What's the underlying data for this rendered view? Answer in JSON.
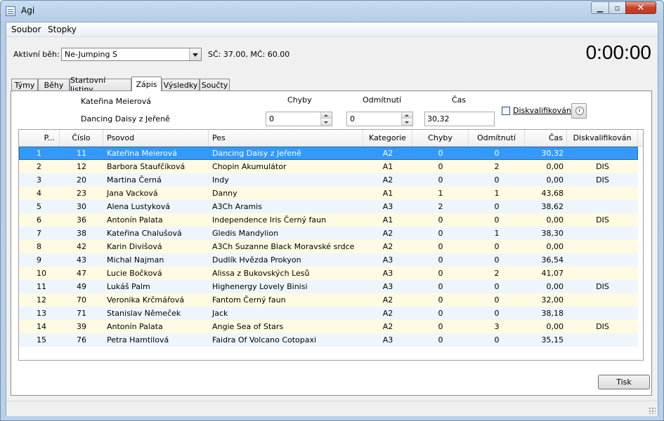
{
  "window": {
    "title": "Agi"
  },
  "menu": {
    "items": [
      "Soubor",
      "Stopky"
    ]
  },
  "run_selector": {
    "label": "Aktivní běh:",
    "value": "Ne-Jumping S"
  },
  "run_info": "SČ: 37.00, MČ: 60.00",
  "timer": "0:00:00",
  "tabs": [
    "Týmy",
    "Běhy",
    "Startovní listiny",
    "Zápis",
    "Výsledky",
    "Součty"
  ],
  "active_tab": "Zápis",
  "entry": {
    "handler": "Kateřina Meierová",
    "dog": "Dancing Daisy z Jeřeně",
    "chyby_label": "Chyby",
    "chyby_value": "0",
    "odmitnuti_label": "Odmítnutí",
    "odmitnuti_value": "0",
    "cas_label": "Čas",
    "cas_value": "30,32",
    "disq_label": "Diskvalifikován",
    "alarm_icon": "alarm-clock-icon"
  },
  "table": {
    "columns": [
      "P...",
      "Číslo",
      "Psovod",
      "Pes",
      "Kategorie",
      "Chyby",
      "Odmítnutí",
      "Čas",
      "Diskvalifikován"
    ],
    "rows": [
      [
        "1",
        "11",
        "Kateřina Meierová",
        "Dancing Daisy z Jeřeně",
        "A2",
        "0",
        "0",
        "30,32",
        ""
      ],
      [
        "2",
        "12",
        "Barbora Staufčíková",
        "Chopin Akumulátor",
        "A1",
        "0",
        "2",
        "0,00",
        "DIS"
      ],
      [
        "3",
        "20",
        "Martina Černá",
        "Indy",
        "A2",
        "0",
        "0",
        "0,00",
        "DIS"
      ],
      [
        "4",
        "23",
        "Jana Vacková",
        "Danny",
        "A1",
        "1",
        "1",
        "43,68",
        ""
      ],
      [
        "5",
        "30",
        "Alena Lustyková",
        "A3Ch Aramis",
        "A3",
        "2",
        "0",
        "38,62",
        ""
      ],
      [
        "6",
        "36",
        "Antonín Palata",
        "Independence Iris Černý faun",
        "A1",
        "0",
        "0",
        "0,00",
        "DIS"
      ],
      [
        "7",
        "38",
        "Kateřina Chalušová",
        "Gledis Mandylion",
        "A2",
        "0",
        "1",
        "38,30",
        ""
      ],
      [
        "8",
        "42",
        "Karin Divišová",
        "A3Ch Suzanne Black Moravské srdce",
        "A2",
        "0",
        "0",
        "0,00",
        ""
      ],
      [
        "9",
        "43",
        "Michal Najman",
        "Dudlík  Hvězda Prokyon",
        "A3",
        "0",
        "0",
        "36,54",
        ""
      ],
      [
        "10",
        "47",
        "Lucie Bočková",
        "Alissa z Bukovských Lesů",
        "A3",
        "0",
        "2",
        "41,07",
        ""
      ],
      [
        "11",
        "49",
        "Lukáš Palm",
        "Highenergy Lovely Binisi",
        "A3",
        "0",
        "0",
        "0,00",
        "DIS"
      ],
      [
        "12",
        "70",
        "Veronika Krčmářová",
        "Fantom Černý faun",
        "A2",
        "0",
        "0",
        "32,00",
        ""
      ],
      [
        "13",
        "71",
        "Stanislav Němeček",
        "Jack",
        "A2",
        "0",
        "0",
        "38,18",
        ""
      ],
      [
        "14",
        "39",
        "Antonín Palata",
        "Angie Sea of Stars",
        "A2",
        "0",
        "3",
        "0,00",
        "DIS"
      ],
      [
        "15",
        "76",
        "Petra Hamtilová",
        "Faidra Of Volcano Cotopaxi",
        "A3",
        "0",
        "0",
        "35,15",
        ""
      ]
    ]
  },
  "print_button": "Tisk",
  "colors": {
    "selection": "#3399ff",
    "alt_row": "#fffbe3",
    "plain_row": "#eef5fc"
  }
}
